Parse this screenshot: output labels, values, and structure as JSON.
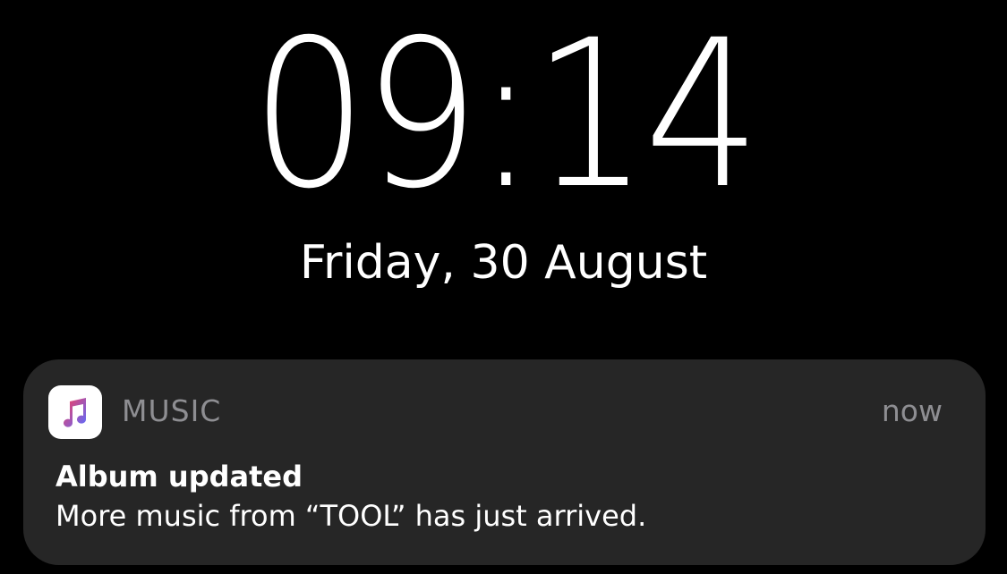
{
  "lockscreen": {
    "time": "09:14",
    "date": "Friday, 30 August"
  },
  "notification": {
    "app_name": "MUSIC",
    "app_icon": "music-note-icon",
    "timestamp": "now",
    "title": "Album updated",
    "body": "More music from “TOOL” has just arrived.",
    "colors": {
      "card_background": "#262626",
      "secondary_text": "#8e8e92",
      "icon_gradient_start": "#fa3c5a",
      "icon_gradient_end": "#5b6cff"
    }
  }
}
